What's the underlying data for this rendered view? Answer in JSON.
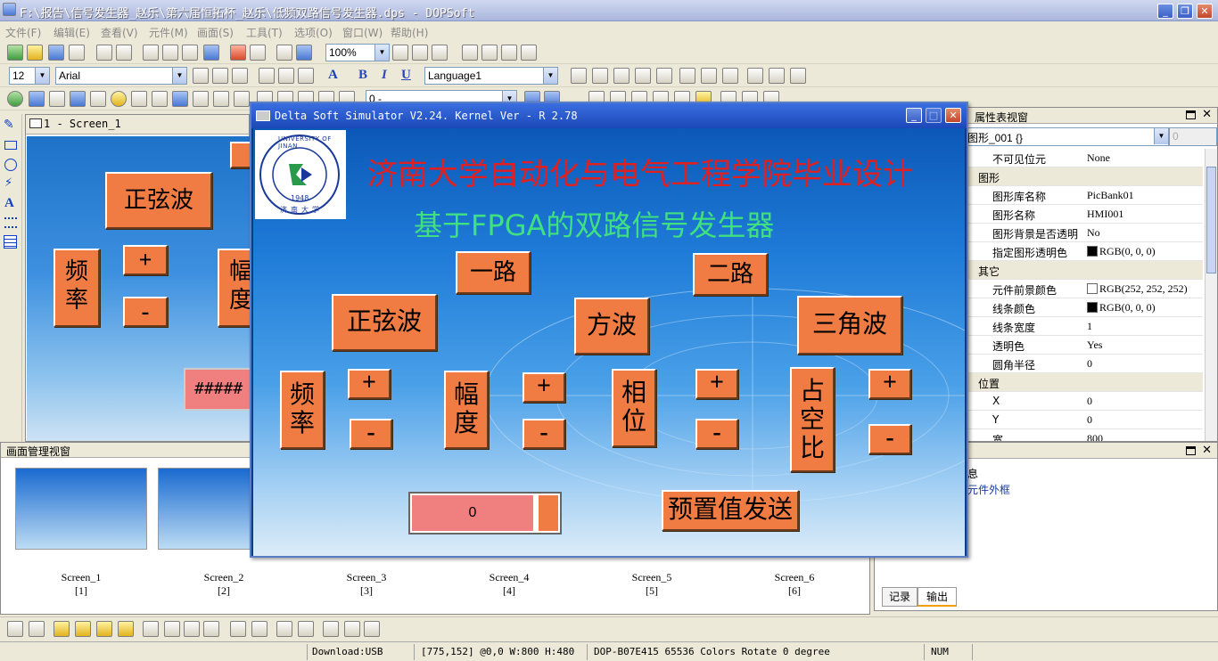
{
  "app": {
    "title": "F:\\报告\\信号发生器_赵乐\\第六届恒拓杯_赵乐\\低频双路信号发生器.dps - DOPSoft"
  },
  "menu": [
    "文件(F)",
    "编辑(E)",
    "查看(V)",
    "元件(M)",
    "画面(S)",
    "工具(T)",
    "选项(O)",
    "窗口(W)",
    "帮助(H)"
  ],
  "toolbar": {
    "zoom": "100%",
    "font_size": "12",
    "font_name": "Arial",
    "language": "Language1",
    "layer": "0 -"
  },
  "editor": {
    "tab_title": "1 - Screen_1",
    "sine": "正弦波",
    "freq": "频\n率",
    "amp": "幅\n度",
    "plus": "+",
    "minus": "-",
    "hash": "#####"
  },
  "simulator": {
    "title": "Delta Soft Simulator V2.24. Kernel Ver - R 2.78",
    "logo_ring": "UNIVERSITY OF JINAN",
    "logo_year": "1948",
    "logo_cn": "济南大学",
    "heading1": "济南大学自动化与电气工程学院毕业设计",
    "heading2": "基于FPGA的双路信号发生器",
    "ch1": "一路",
    "ch2": "二路",
    "sine": "正弦波",
    "square": "方波",
    "triangle": "三角波",
    "freq": "频\n率",
    "amp": "幅\n度",
    "phase": "相\n位",
    "duty": "占\n空\n比",
    "plus": "+",
    "minus": "-",
    "value": "0",
    "send": "预置值发送"
  },
  "properties": {
    "title": "属性表视窗",
    "object": "图形_001 {}",
    "rows": [
      {
        "k": "不可见位元",
        "v": "None"
      },
      {
        "k": "图形",
        "group": true
      },
      {
        "k": "图形库名称",
        "v": "PicBank01"
      },
      {
        "k": "图形名称",
        "v": "HMI001"
      },
      {
        "k": "图形背景是否透明",
        "v": "No"
      },
      {
        "k": "指定图形透明色",
        "v": "RGB(0, 0, 0)",
        "swatch": "#000000"
      },
      {
        "k": "其它",
        "group": true
      },
      {
        "k": "元件前景颜色",
        "v": "RGB(252, 252, 252)",
        "swatch": "#fcfcfc"
      },
      {
        "k": "线条颜色",
        "v": "RGB(0, 0, 0)",
        "swatch": "#000000"
      },
      {
        "k": "线条宽度",
        "v": "1"
      },
      {
        "k": "透明色",
        "v": "Yes"
      },
      {
        "k": "圆角半径",
        "v": "0"
      },
      {
        "k": "位置",
        "group": true
      },
      {
        "k": "X",
        "v": "0"
      },
      {
        "k": "Y",
        "v": "0"
      },
      {
        "k": "宽",
        "v": "800"
      }
    ]
  },
  "manager": {
    "title": "画面管理视窗",
    "screens": [
      {
        "name": "Screen_1",
        "idx": "[1]"
      },
      {
        "name": "Screen_2",
        "idx": "[2]"
      },
      {
        "name": "Screen_3",
        "idx": "[3]"
      },
      {
        "name": "Screen_4",
        "idx": "[4]"
      },
      {
        "name": "Screen_5",
        "idx": "[5]"
      },
      {
        "name": "Screen_6",
        "idx": "[6]"
      }
    ]
  },
  "output": {
    "col": "息",
    "line": "元件外框",
    "tabs": [
      "记录",
      "输出"
    ]
  },
  "status": {
    "download": "Download:USB",
    "coords": "[775,152] @0,0 W:800 H:480",
    "device": "DOP-B07E415 65536 Colors Rotate 0 degree",
    "num": "NUM"
  },
  "colors": {
    "button": "#f07c44",
    "value_box": "#f08080",
    "heading1": "#e02020",
    "heading2": "#40e080"
  }
}
